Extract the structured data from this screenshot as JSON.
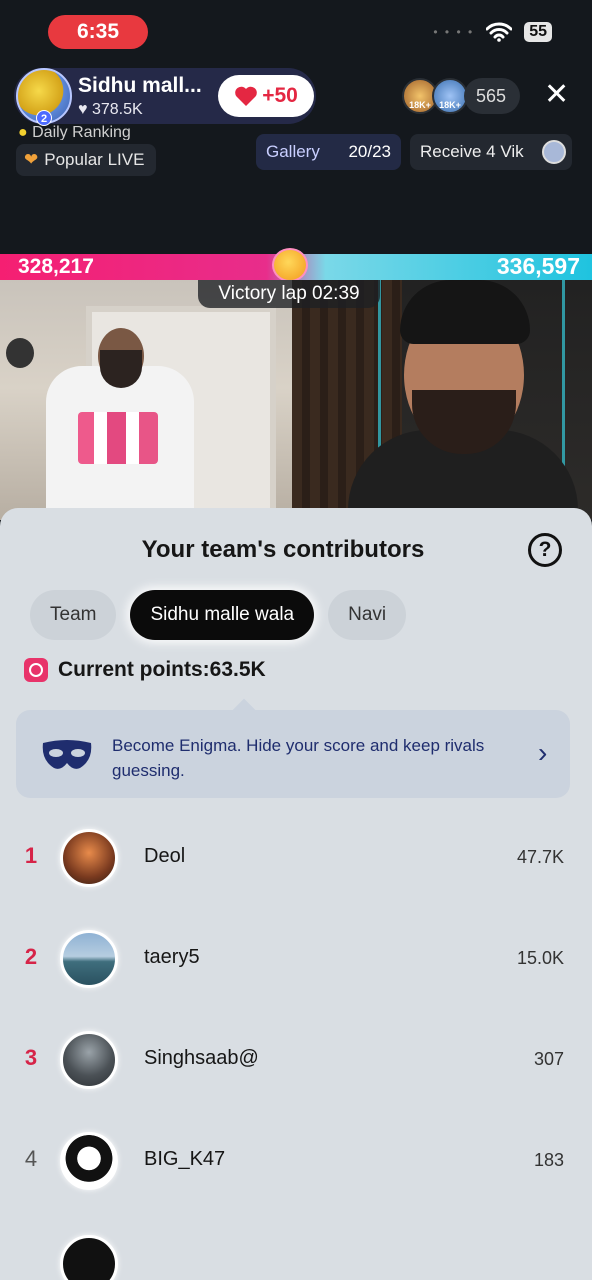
{
  "status_bar": {
    "time": "6:35",
    "battery": "55"
  },
  "host": {
    "name": "Sidhu mall...",
    "likes": "378.5K",
    "level": "2",
    "follow_label": "+50"
  },
  "viewers": {
    "badge_1": "18K+",
    "badge_2": "18K+",
    "count": "565"
  },
  "ranking": {
    "daily": "Daily Ranking",
    "popular": "Popular LIVE"
  },
  "gallery": {
    "label": "Gallery",
    "count": "20/23"
  },
  "receive": {
    "label": "Receive 4 Vik"
  },
  "battle": {
    "left_score": "328,217",
    "right_score": "336,597",
    "timer": "Victory lap 02:39"
  },
  "panel": {
    "title": "Your team's contributors",
    "help": "?",
    "tabs": [
      {
        "label": "Team",
        "active": false
      },
      {
        "label": "Sidhu malle wala",
        "active": true
      },
      {
        "label": "Navi",
        "active": false
      }
    ],
    "points": "Current points:63.5K",
    "enigma": {
      "text": "Become Enigma. Hide your score and keep rivals guessing."
    },
    "contributors": [
      {
        "rank": "1",
        "name": "Deol",
        "score": "47.7K"
      },
      {
        "rank": "2",
        "name": "taery5",
        "score": "15.0K"
      },
      {
        "rank": "3",
        "name": "Singhsaab@",
        "score": "307"
      },
      {
        "rank": "4",
        "name": "BIG_K47",
        "score": "183"
      }
    ]
  },
  "colors": {
    "accent_red": "#e8393f",
    "battle_pink": "#f51f72",
    "battle_cyan": "#1fc3df",
    "rank_red": "#d62448",
    "enigma_blue": "#1f2d6e"
  }
}
